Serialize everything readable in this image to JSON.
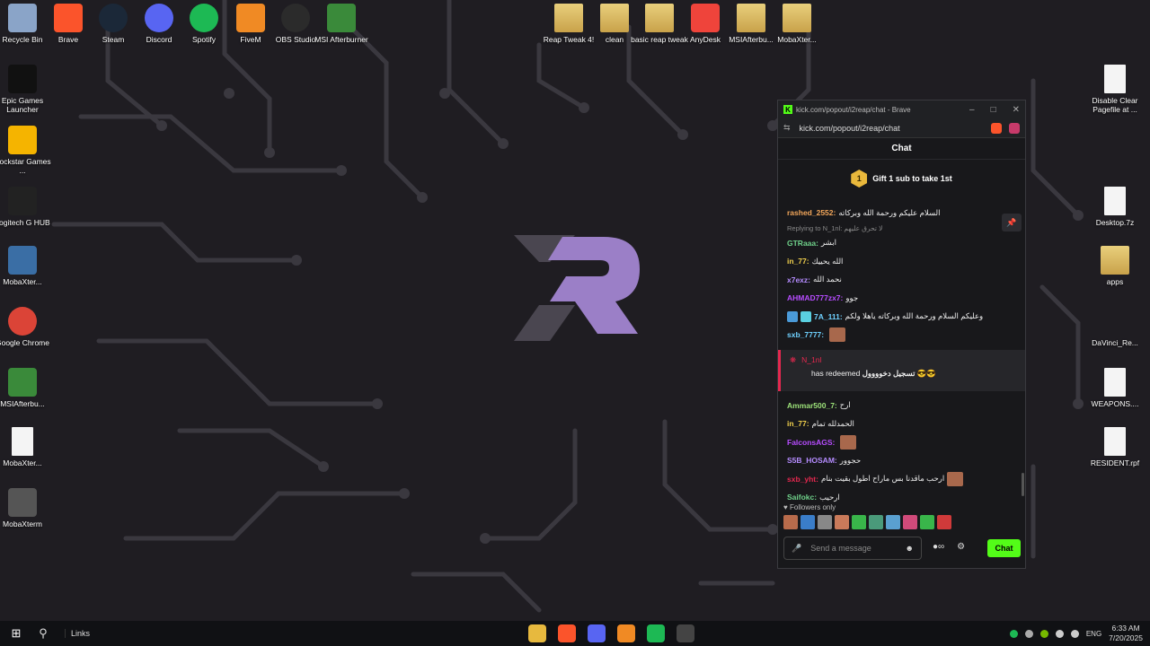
{
  "desktop_left": [
    {
      "label": "Recycle Bin",
      "icon": "recycle-bin-icon",
      "color": "#8aa4c8"
    },
    {
      "label": "Epic Games Launcher",
      "icon": "epic-games-icon",
      "color": "#111111"
    },
    {
      "label": "Rockstar Games ...",
      "icon": "rockstar-icon",
      "color": "#f5b400"
    },
    {
      "label": "Logitech G HUB",
      "icon": "logitech-icon",
      "color": "#222222"
    },
    {
      "label": "MobaXter...",
      "icon": "mobaxterm-icon",
      "color": "#3a6ea5"
    },
    {
      "label": "Google Chrome",
      "icon": "chrome-icon",
      "color": "#db4437"
    },
    {
      "label": "MSIAfterbu...",
      "icon": "msi-afterburner-icon",
      "color": "#3a8a3a"
    },
    {
      "label": "MobaXter...",
      "icon": "file-icon",
      "color": "#f4f4f4"
    },
    {
      "label": "MobaXterm",
      "icon": "mobaxterm-icon",
      "color": "#555555"
    }
  ],
  "desktop_top": [
    {
      "label": "Brave",
      "icon": "brave-icon",
      "color": "#fb542b"
    },
    {
      "label": "Steam",
      "icon": "steam-icon",
      "color": "#1b2838"
    },
    {
      "label": "Discord",
      "icon": "discord-icon",
      "color": "#5865f2"
    },
    {
      "label": "Spotify",
      "icon": "spotify-icon",
      "color": "#1db954"
    },
    {
      "label": "FiveM",
      "icon": "fivem-icon",
      "color": "#f08a24"
    },
    {
      "label": "OBS Studio",
      "icon": "obs-icon",
      "color": "#2b2b2b"
    },
    {
      "label": "MSI Afterburner",
      "icon": "msi-afterburner-icon",
      "color": "#3a8a3a"
    }
  ],
  "desktop_top_right": [
    {
      "label": "Reap Tweak 4!",
      "icon": "zip-folder-icon"
    },
    {
      "label": "clean",
      "icon": "zip-folder-icon"
    },
    {
      "label": "basic reap tweak",
      "icon": "zip-folder-icon"
    },
    {
      "label": "AnyDesk",
      "icon": "anydesk-icon",
      "color": "#ef443b"
    },
    {
      "label": "MSIAfterbu...",
      "icon": "zip-folder-icon"
    },
    {
      "label": "MobaXter...",
      "icon": "zip-folder-icon"
    }
  ],
  "desktop_right": [
    {
      "label": "Disable Clear Pagefile at ...",
      "icon": "script-icon"
    },
    {
      "label": "Desktop.7z",
      "icon": "file-icon"
    },
    {
      "label": "apps",
      "icon": "folder-icon"
    },
    {
      "label": "DaVinci_Re...",
      "icon": "davinci-icon"
    },
    {
      "label": "WEAPONS....",
      "icon": "file-icon"
    },
    {
      "label": "RESIDENT.rpf",
      "icon": "file-icon"
    }
  ],
  "popup": {
    "title": "kick.com/popout/i2reap/chat - Brave",
    "url": "kick.com/popout/i2reap/chat",
    "chat_title": "Chat",
    "gift_text": "Gift 1 sub to take 1st",
    "gift_rank": "1",
    "messages": [
      {
        "user": "rashed_2552:",
        "text": "السلام عليكم ورحمة الله وبركاته",
        "color": "#f2a65a"
      },
      {
        "reply": "Replying to N_1nl: لا تحرق عليهم"
      },
      {
        "user": "GTRaaa:",
        "text": "ابشر",
        "color": "#6fd18a"
      },
      {
        "user": "in_77:",
        "text": "الله يحييك",
        "color": "#f2d14d"
      },
      {
        "user": "x7exz:",
        "text": "نحمد الله",
        "color": "#b58cff"
      },
      {
        "user": "AHMAD777zx7:",
        "text": "جوو",
        "color": "#b74cff"
      },
      {
        "user": "7A_111:",
        "text": "وعليكم السلام ورحمة الله وبركاته ياهلا ولكم",
        "color": "#6fd1ff",
        "badges": true
      },
      {
        "user": "sxb_7777:",
        "text": "",
        "color": "#6fd1ff",
        "emote": true
      }
    ],
    "redeem": {
      "user": "N_1nl",
      "text": "has redeemed",
      "reward": "تسجيل دخوووول 😎😎"
    },
    "messages2": [
      {
        "user": "Ammar500_7:",
        "text": "ارح",
        "color": "#9de37a"
      },
      {
        "user": "in_77:",
        "text": "الحمدلله تمام",
        "color": "#f2d14d"
      },
      {
        "user": "FalconsAGS:",
        "text": "",
        "color": "#b74cff",
        "emote": true
      },
      {
        "user": "S5B_HOSAM:",
        "text": "حجوور",
        "color": "#b58cff"
      },
      {
        "user": "sxb_yht:",
        "text": "ارحب ماقدنا بس ماراح اطول بقيت بنام",
        "color": "#e5284f",
        "emote": true
      },
      {
        "user": "Saifokc:",
        "text": "ارحيب",
        "color": "#6fd18a"
      }
    ],
    "followers_only": "Followers only",
    "input_placeholder": "Send a message",
    "send_label": "Chat",
    "emote_colors": [
      "#b86b4b",
      "#3a7dc9",
      "#888888",
      "#c97a5a",
      "#39b54a",
      "#4a9a7a",
      "#5aa0d0",
      "#d04a7a",
      "#39b54a",
      "#d03a3a"
    ]
  },
  "taskbar": {
    "links_label": "Links",
    "time": "6:33 AM",
    "date": "7/20/2025",
    "lang": "ENG",
    "apps": [
      {
        "name": "file-explorer-icon",
        "color": "#e7b93e"
      },
      {
        "name": "brave-icon",
        "color": "#fb542b"
      },
      {
        "name": "discord-icon",
        "color": "#5865f2"
      },
      {
        "name": "fivem-icon",
        "color": "#f08a24"
      },
      {
        "name": "spotify-icon",
        "color": "#1db954"
      },
      {
        "name": "obs-icon",
        "color": "#444444"
      }
    ]
  }
}
